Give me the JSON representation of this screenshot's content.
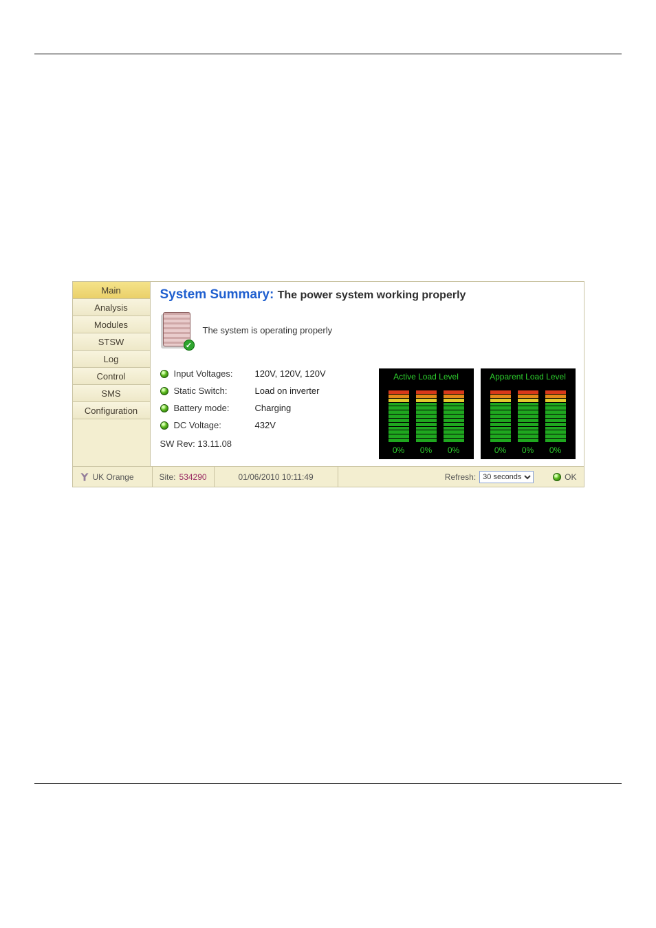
{
  "sidebar": {
    "items": [
      {
        "label": "Main",
        "active": true
      },
      {
        "label": "Analysis",
        "active": false
      },
      {
        "label": "Modules",
        "active": false
      },
      {
        "label": "STSW",
        "active": false
      },
      {
        "label": "Log",
        "active": false
      },
      {
        "label": "Control",
        "active": false
      },
      {
        "label": "SMS",
        "active": false
      },
      {
        "label": "Configuration",
        "active": false
      }
    ]
  },
  "header": {
    "title_prefix": "System Summary: ",
    "title_suffix": "The power system working properly"
  },
  "status": {
    "summary": "The system is operating properly"
  },
  "details": {
    "input_voltages": {
      "label": "Input Voltages:",
      "value": "120V, 120V, 120V"
    },
    "static_switch": {
      "label": "Static Switch:",
      "value": "Load on inverter"
    },
    "battery_mode": {
      "label": "Battery mode:",
      "value": "Charging"
    },
    "dc_voltage": {
      "label": "DC Voltage:",
      "value": "432V"
    },
    "sw_rev": "SW Rev: 13.11.08"
  },
  "gauges": {
    "active": {
      "title": "Active Load Level",
      "bars": [
        "0%",
        "0%",
        "0%"
      ]
    },
    "apparent": {
      "title": "Apparent Load Level",
      "bars": [
        "0%",
        "0%",
        "0%"
      ]
    }
  },
  "footer": {
    "brand": "UK Orange",
    "site_label": "Site:",
    "site_id": "534290",
    "timestamp": "01/06/2010 10:11:49",
    "refresh_label": "Refresh:",
    "refresh_selected": "30 seconds",
    "ok_label": "OK"
  }
}
